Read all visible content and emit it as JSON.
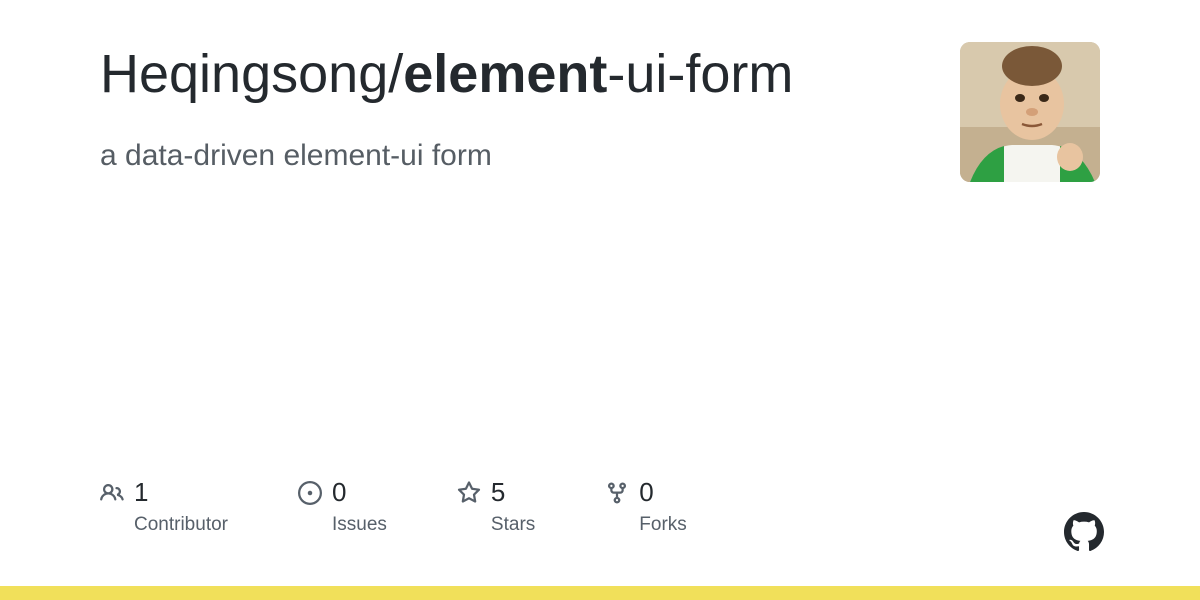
{
  "repo": {
    "owner": "Heqingsong",
    "slash": "/",
    "name_parts": {
      "bold": "element",
      "rest": "-ui-form"
    }
  },
  "description": "a data-driven element-ui form",
  "stats": [
    {
      "value": "1",
      "label": "Contributor",
      "icon": "people-icon"
    },
    {
      "value": "0",
      "label": "Issues",
      "icon": "issue-icon"
    },
    {
      "value": "5",
      "label": "Stars",
      "icon": "star-icon"
    },
    {
      "value": "0",
      "label": "Forks",
      "icon": "fork-icon"
    }
  ],
  "colors": {
    "language_bar": "#f1e05a"
  }
}
